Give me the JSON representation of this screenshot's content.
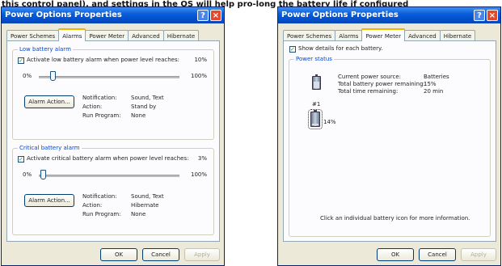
{
  "caption": "this control panel), and settings in the OS will help pro-long the battery life if configured",
  "left_window": {
    "title": "Power Options Properties",
    "help_glyph": "?",
    "close_glyph": "×",
    "tabs": [
      "Power Schemes",
      "Alarms",
      "Power Meter",
      "Advanced",
      "Hibernate"
    ],
    "active_tab": "Alarms",
    "low_alarm": {
      "group_label": "Low battery alarm",
      "checkbox_label": "Activate low battery alarm when power level reaches:",
      "checked": true,
      "percent": "10%",
      "level": 0.1,
      "min_label": "0%",
      "max_label": "100%",
      "action_button": "Alarm Action...",
      "notification_label": "Notification:",
      "notification_value": "Sound, Text",
      "action_label": "Action:",
      "action_value": "Stand by",
      "run_label": "Run Program:",
      "run_value": "None"
    },
    "critical_alarm": {
      "group_label": "Critical battery alarm",
      "checkbox_label": "Activate critical battery alarm when power level reaches:",
      "checked": true,
      "percent": "3%",
      "level": 0.03,
      "min_label": "0%",
      "max_label": "100%",
      "action_button": "Alarm Action...",
      "notification_label": "Notification:",
      "notification_value": "Sound, Text",
      "action_label": "Action:",
      "action_value": "Hibernate",
      "run_label": "Run Program:",
      "run_value": "None"
    },
    "buttons": {
      "ok": "OK",
      "cancel": "Cancel",
      "apply": "Apply"
    }
  },
  "right_window": {
    "title": "Power Options Properties",
    "help_glyph": "?",
    "close_glyph": "×",
    "tabs": [
      "Power Schemes",
      "Alarms",
      "Power Meter",
      "Advanced",
      "Hibernate"
    ],
    "active_tab": "Power Meter",
    "show_details_label": "Show details for each battery.",
    "show_details_checked": true,
    "power_status_label": "Power status",
    "current_source_label": "Current power source:",
    "current_source_value": "Batteries",
    "remaining_label": "Total battery power remaining:",
    "remaining_value": "15%",
    "time_label": "Total time remaining:",
    "time_value": "20 min",
    "battery_number": "#1",
    "battery_percent": "14%",
    "battery_level": 0.14,
    "hint": "Click an individual battery icon for more information.",
    "buttons": {
      "ok": "OK",
      "cancel": "Cancel",
      "apply": "Apply"
    }
  }
}
